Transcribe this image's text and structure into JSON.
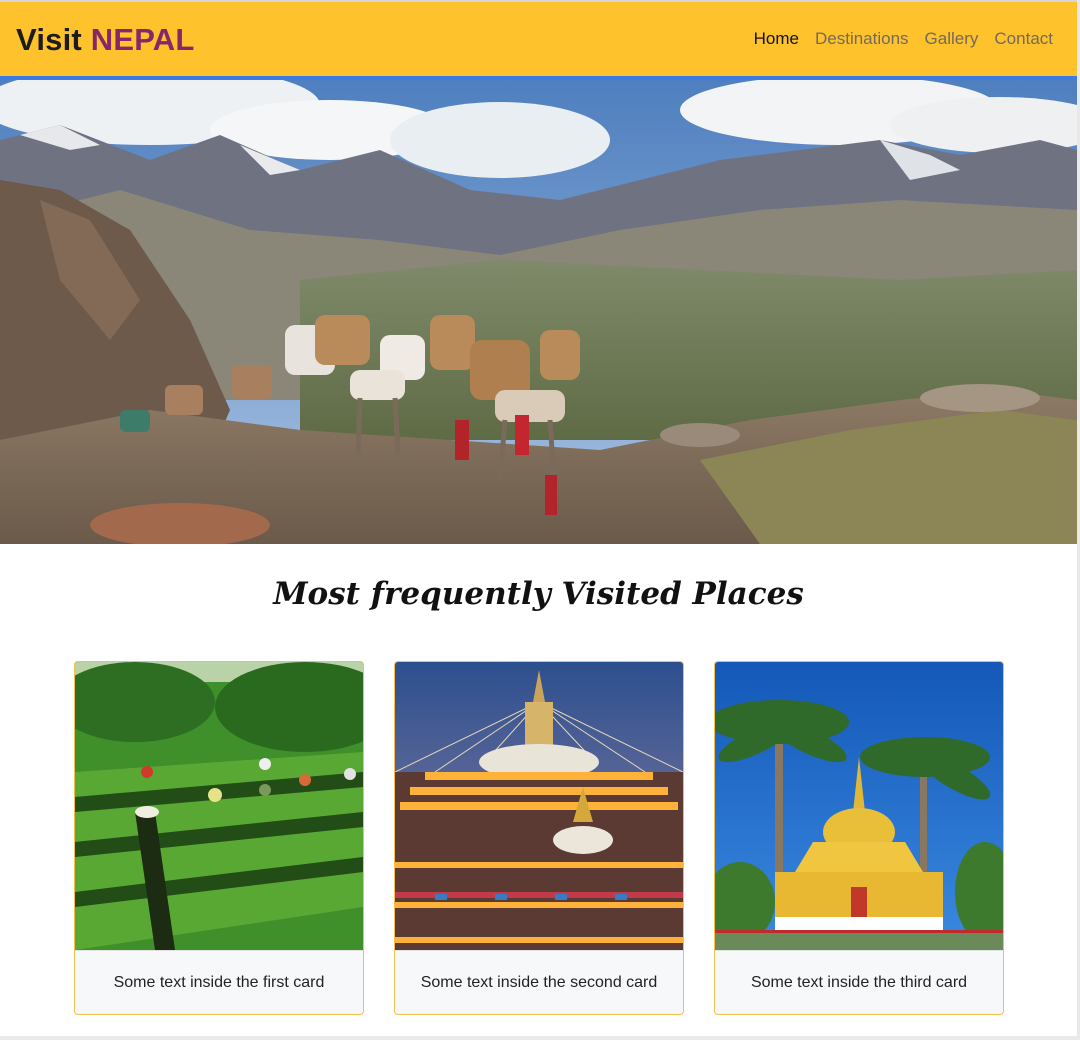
{
  "brand": {
    "prefix": "Visit",
    "name": "NEPAL"
  },
  "nav": {
    "items": [
      {
        "label": "Home",
        "active": true
      },
      {
        "label": "Destinations",
        "active": false
      },
      {
        "label": "Gallery",
        "active": false
      },
      {
        "label": "Contact",
        "active": false
      }
    ]
  },
  "hero": {
    "image": "mountain-caravan-photo"
  },
  "section": {
    "title": "Most frequently Visited Places"
  },
  "cards": [
    {
      "image": "tea-garden-photo",
      "text": "Some text inside the first card"
    },
    {
      "image": "boudhanath-stupa-photo",
      "text": "Some text inside the second card"
    },
    {
      "image": "golden-pagoda-photo",
      "text": "Some text inside the third card"
    }
  ],
  "colors": {
    "navbar_bg": "#fec22c",
    "navbar_border": "#3d7ae3",
    "brand_accent": "#86266b",
    "card_border": "#f0c14b"
  }
}
